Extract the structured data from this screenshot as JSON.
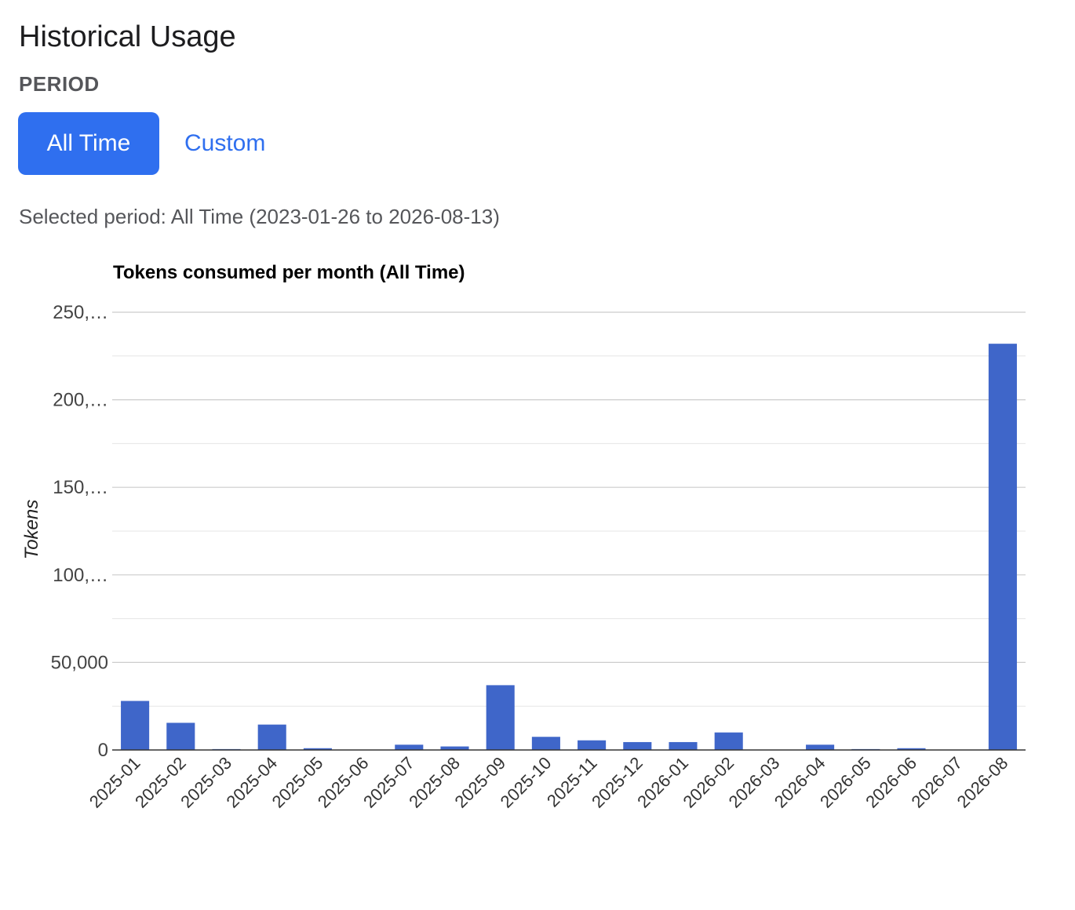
{
  "header": {
    "title": "Historical Usage",
    "period_label": "PERIOD"
  },
  "period_toggle": {
    "all_time_label": "All Time",
    "custom_label": "Custom",
    "active": "All Time"
  },
  "selected_period": {
    "prefix": "Selected period: ",
    "value": "All Time",
    "start": "2023-01-26",
    "connector": "to",
    "end": "2026-08-13"
  },
  "colors": {
    "accent": "#2f6fef",
    "bar": "#3f66c9",
    "gridline": "#cccccc",
    "minor_gridline": "#e5e5e5",
    "axis": "#333333"
  },
  "chart_data": {
    "type": "bar",
    "title": "Tokens consumed per month (All Time)",
    "xlabel": "",
    "ylabel": "Tokens",
    "categories": [
      "2025-01",
      "2025-02",
      "2025-03",
      "2025-04",
      "2025-05",
      "2025-06",
      "2025-07",
      "2025-08",
      "2025-09",
      "2025-10",
      "2025-11",
      "2025-12",
      "2026-01",
      "2026-02",
      "2026-03",
      "2026-04",
      "2026-05",
      "2026-06",
      "2026-07",
      "2026-08"
    ],
    "values": [
      28000,
      15500,
      500,
      14500,
      1000,
      0,
      3000,
      2000,
      37000,
      7500,
      5500,
      4500,
      4500,
      10000,
      0,
      3000,
      500,
      1000,
      0,
      232000
    ],
    "ylim": [
      0,
      250000
    ],
    "yticks": [
      0,
      50000,
      100000,
      150000,
      200000,
      250000
    ],
    "ytick_labels": [
      "0",
      "50,000",
      "100,…",
      "150,…",
      "200,…",
      "250,…"
    ],
    "grid": true,
    "legend": "none"
  }
}
